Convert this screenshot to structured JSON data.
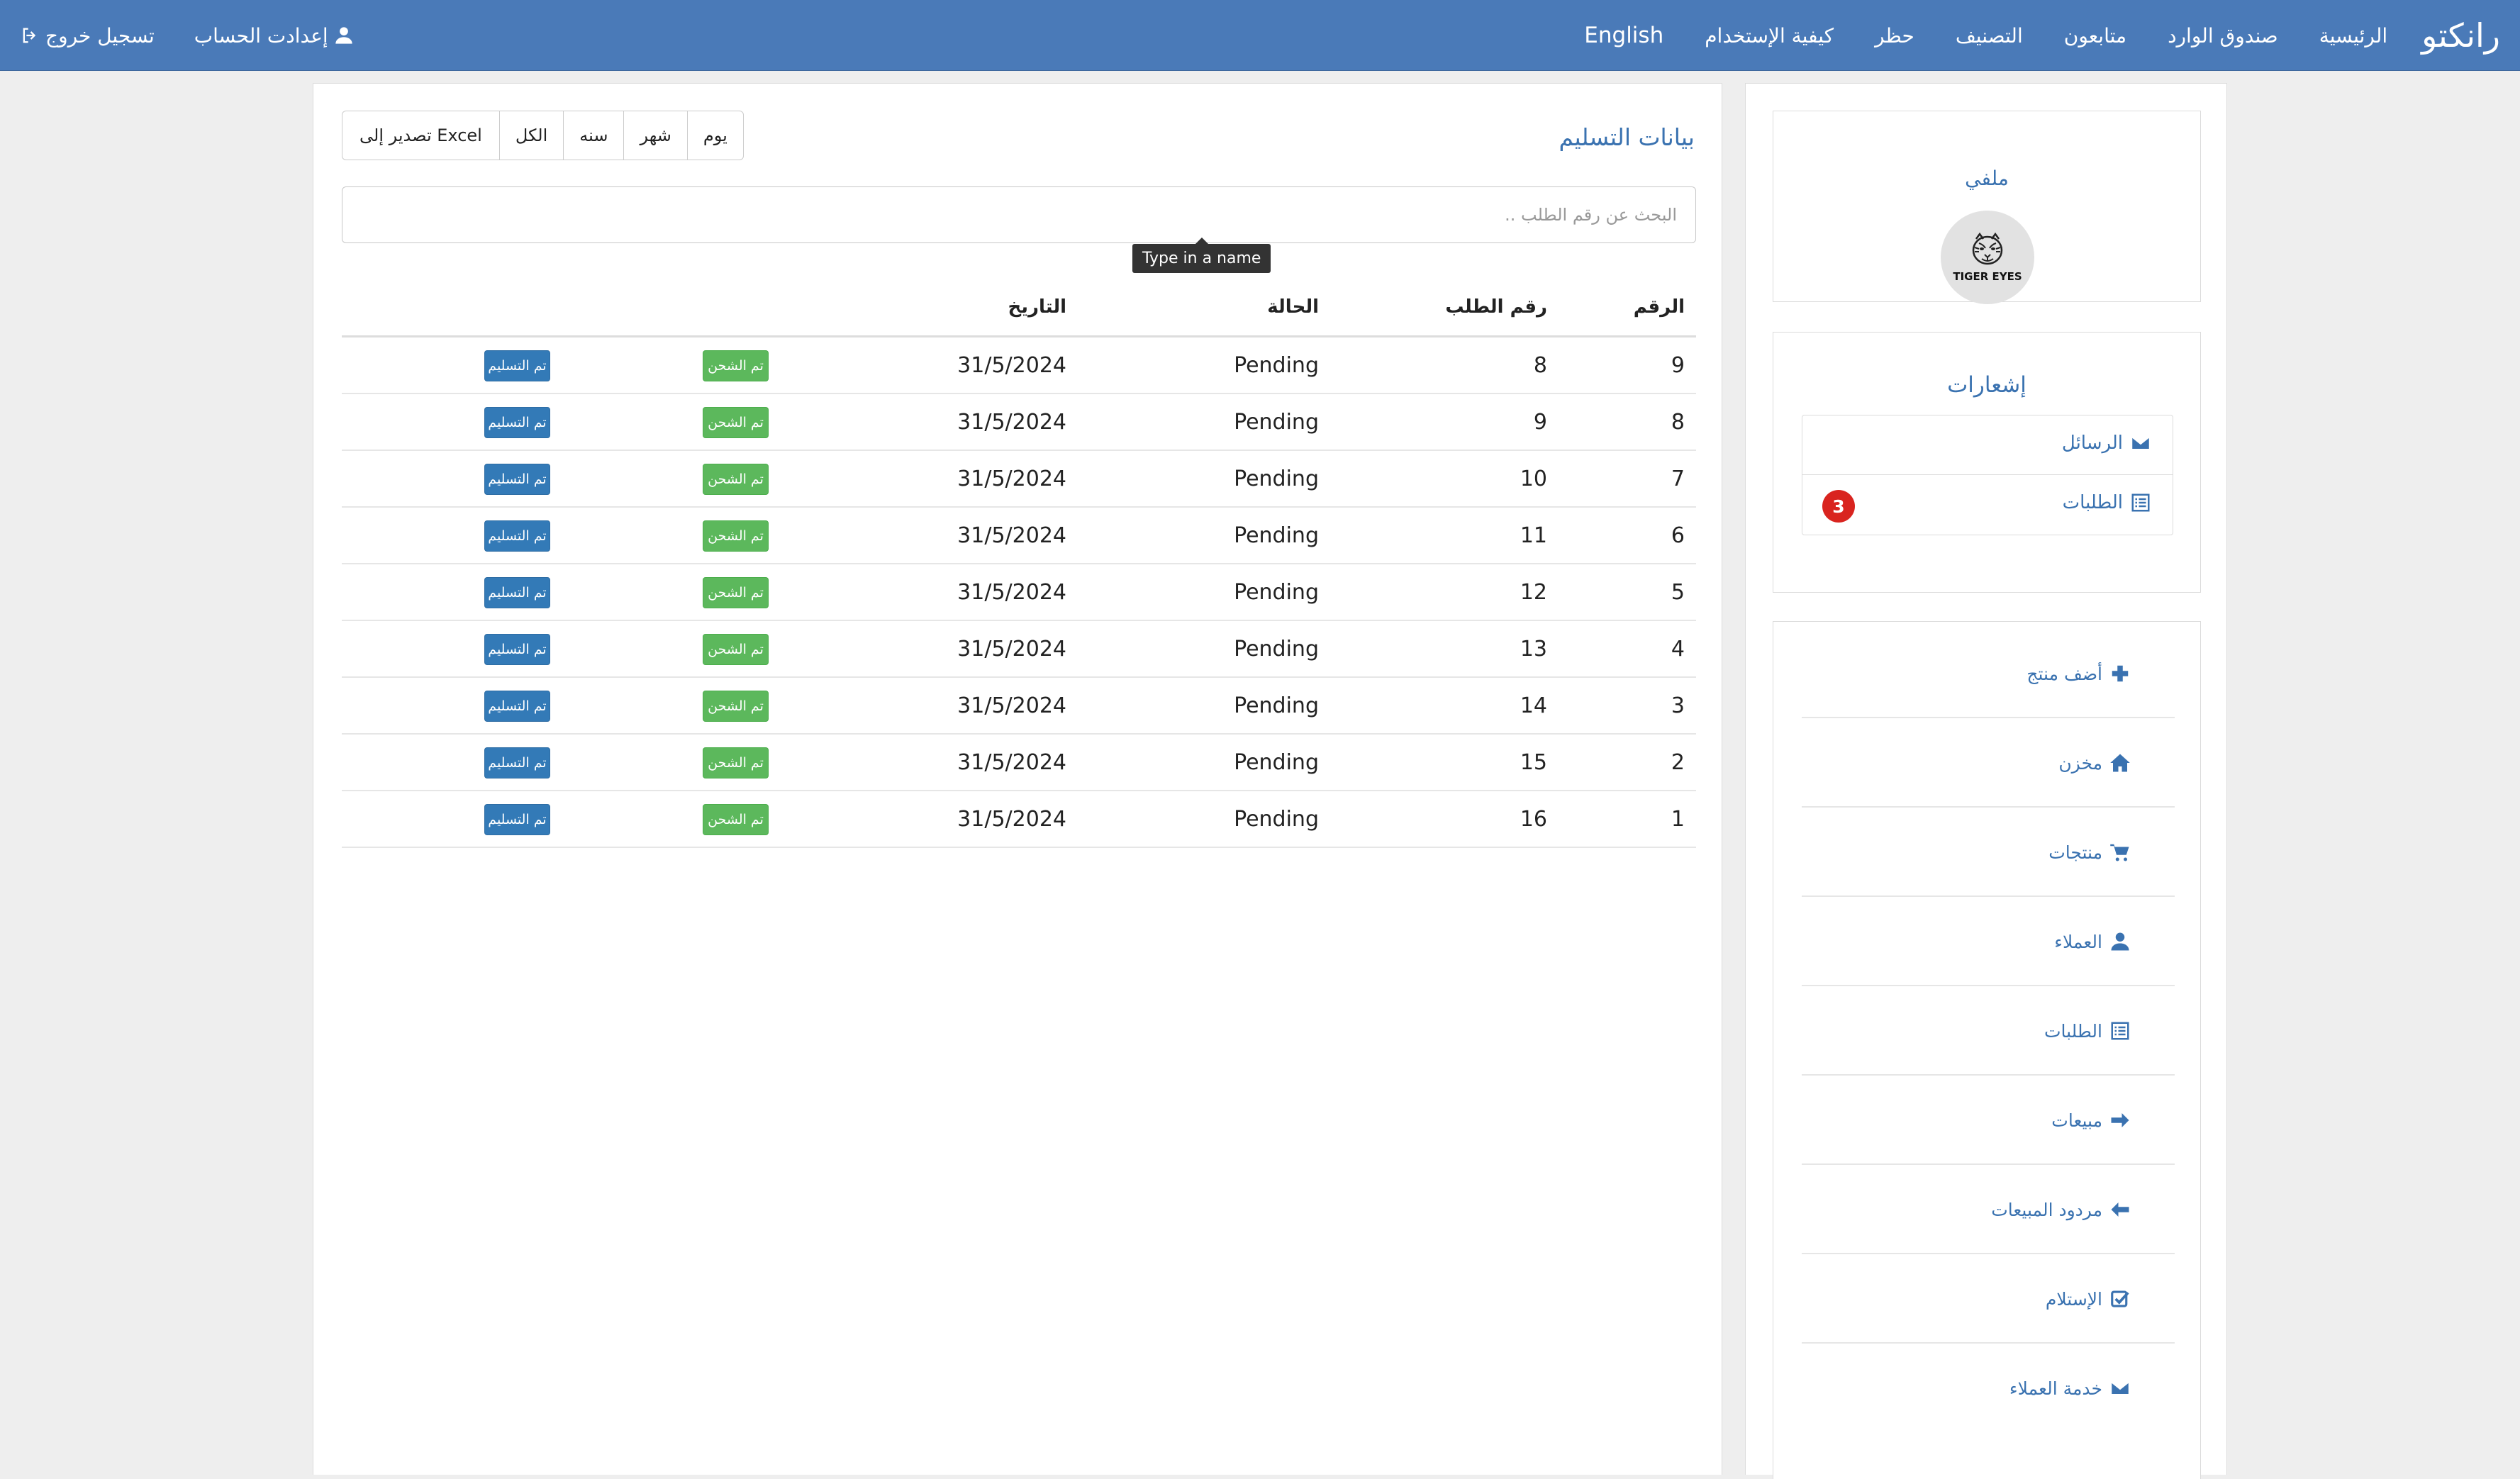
{
  "navbar": {
    "brand": "رانكتو",
    "links": [
      "الرئيسية",
      "صندوق الوارد",
      "متابعون",
      "التصنيف",
      "حظر",
      "كيفية الإستخدام"
    ],
    "language": "English",
    "account_settings": "إعدادت الحساب",
    "logout": "تسجيل خروج"
  },
  "main": {
    "title": "بيانات التسليم",
    "filters": [
      "يوم",
      "شهر",
      "سنه",
      "الكل",
      "تصدير إلى Excel"
    ],
    "search_placeholder": "البحث عن رقم الطلب ..",
    "tooltip": "Type in a name",
    "table": {
      "headers": {
        "num": "الرقم",
        "order": "رقم الطلب",
        "status": "الحالة",
        "date": "التاريخ"
      },
      "ship_label": "تم الشحن",
      "deliver_label": "تم التسليم",
      "rows": [
        {
          "num": "9",
          "order": "8",
          "status": "Pending",
          "date": "31/5/2024"
        },
        {
          "num": "8",
          "order": "9",
          "status": "Pending",
          "date": "31/5/2024"
        },
        {
          "num": "7",
          "order": "10",
          "status": "Pending",
          "date": "31/5/2024"
        },
        {
          "num": "6",
          "order": "11",
          "status": "Pending",
          "date": "31/5/2024"
        },
        {
          "num": "5",
          "order": "12",
          "status": "Pending",
          "date": "31/5/2024"
        },
        {
          "num": "4",
          "order": "13",
          "status": "Pending",
          "date": "31/5/2024"
        },
        {
          "num": "3",
          "order": "14",
          "status": "Pending",
          "date": "31/5/2024"
        },
        {
          "num": "2",
          "order": "15",
          "status": "Pending",
          "date": "31/5/2024"
        },
        {
          "num": "1",
          "order": "16",
          "status": "Pending",
          "date": "31/5/2024"
        }
      ]
    }
  },
  "sidebar": {
    "profile": {
      "title": "ملفي",
      "logo_text": "TIGER EYES"
    },
    "notifications": {
      "title": "إشعارات",
      "items": [
        {
          "label": "الرسائل",
          "icon": "envelope-icon"
        },
        {
          "label": "الطلبات",
          "icon": "list-icon",
          "badge": "3"
        }
      ]
    },
    "menu": [
      {
        "label": "أضف منتج",
        "icon": "plus-icon"
      },
      {
        "label": "مخزن",
        "icon": "home-icon"
      },
      {
        "label": "منتجات",
        "icon": "cart-icon"
      },
      {
        "label": "العملاء",
        "icon": "user-icon"
      },
      {
        "label": "الطلبات",
        "icon": "list-icon"
      },
      {
        "label": "مبيعات",
        "icon": "arrow-right-icon"
      },
      {
        "label": "مردود المبيعات",
        "icon": "arrow-left-icon"
      },
      {
        "label": "الإستلام",
        "icon": "check-square-icon"
      },
      {
        "label": "خدمة العملاء",
        "icon": "envelope-icon"
      }
    ]
  },
  "colors": {
    "navbar": "#4a7ab8",
    "link": "#3a72b0",
    "ship": "#5cb85c",
    "deliver": "#337ab7",
    "badge": "#d9241f"
  }
}
